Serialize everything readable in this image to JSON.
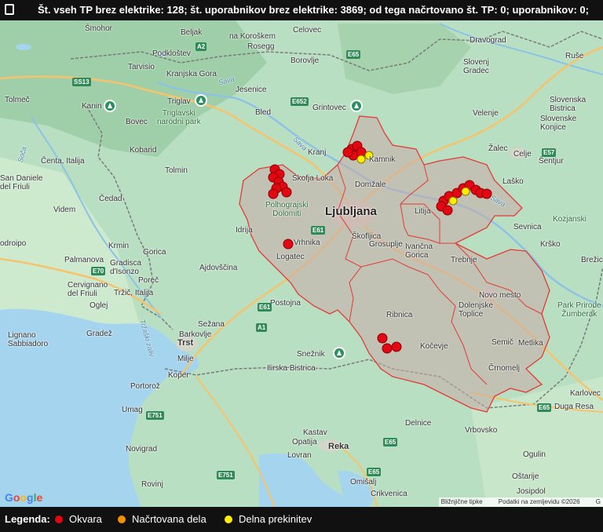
{
  "status_bar": {
    "text": "Št. vseh TP brez elektrike: 128; št. uporabnikov brez elektrike: 3869; od tega načrtovano št. TP: 0; uporabnikov: 0;"
  },
  "map": {
    "places": {
      "beljak": "Beljak",
      "celovec": "Celovec",
      "smohor": "Šmohor",
      "podklostev": "Podkloštev",
      "na_koroskem": "na Koroškem",
      "dravograd": "Dravograd",
      "rosegg": "Rosegg",
      "tarvisio": "Tarvisio",
      "kranjska_gora": "Kranjska Gora",
      "borovlje": "Borovlje",
      "slovenj_gradec": "Slovenj\nGradec",
      "ruse": "Ruše",
      "tolmec": "Tolmeč",
      "kanin": "Kanin",
      "triglav": "Triglav",
      "jesenice": "Jesenice",
      "grintovec": "Grintovec",
      "velenje": "Velenje",
      "slovenska_bistrica": "Slovenska\nBistrica",
      "triglavski_park": "Triglavski\nnarodni park",
      "bovec": "Bovec",
      "bled": "Bled",
      "slovenske_konjice": "Slovenske\nKonjice",
      "kobarid": "Kobarid",
      "kranj": "Kranj",
      "zalec": "Žalec",
      "celje": "Celje",
      "sentjur": "Šentjur",
      "centa_italija": "Čenta, Italija",
      "san_daniele": "San Daniele\ndel Friuli",
      "tolmin": "Tolmin",
      "skofja_loka": "Škofja Loka",
      "kamnik": "Kamnik",
      "domzale": "Domžale",
      "lasko": "Laško",
      "cedad": "Čedad",
      "polhograjski": "Polhograjski\nDolomiti",
      "ljubljana": "Ljubljana",
      "litija": "Litija",
      "kozjanski": "Kozjanski",
      "videm": "Videm",
      "idrija": "Idrija",
      "sevnica": "Sevnica",
      "codroipo": "odroipo",
      "krmin": "Krmin",
      "vrhnika": "Vrhnika",
      "skofljica": "Škofljica",
      "grosuplje": "Grosuplje",
      "ivancna_gorica": "Ivančna\nGorica",
      "krsko": "Krško",
      "gorica": "Gorica",
      "logatec": "Logatec",
      "brezice": "Brežic",
      "palmanova": "Palmanova",
      "gradisca": "Gradisca\nd'Isonzo",
      "ajdovscina": "Ajdovščina",
      "trebnje": "Trebnje",
      "cervignano": "Cervignano\ndel Friuli",
      "porec": "Poreč",
      "trzic_italija": "Tržič, Italija",
      "novo_mesto": "Novo mesto",
      "oglej": "Oglej",
      "postojna": "Postojna",
      "dolenjske_toplice": "Dolenjske\nToplice",
      "park_zumberak": "Park Prirode\nŽumberak",
      "ribnica": "Ribnica",
      "lignano": "Lignano\nSabbiadoro",
      "gradez": "Gradež",
      "sezana": "Sežana",
      "barkovlje": "Barkovlje",
      "trzaski_zaliv": "Tržaški zaliv",
      "trst": "Trst",
      "snieznik": "Snežnik",
      "kocevje": "Kočevje",
      "semic": "Semič",
      "metlika": "Metlika",
      "milje": "Milje",
      "ilirska_bistrica": "Ilirska Bistrica",
      "crnomelj": "Črnomelj",
      "koper": "Koper",
      "karlovec": "Karlovec",
      "portoroz": "Portorož",
      "duga_resa": "Duga Resa",
      "umag": "Umag",
      "delnice": "Delnice",
      "vrbovsko": "Vrbovsko",
      "kastav": "Kastav",
      "opatija": "Opatija",
      "reka": "Reka",
      "novigrad": "Novigrad",
      "lovran": "Lovran",
      "ogulin": "Ogulin",
      "omisalj": "Omišalj",
      "ostarije": "Oštarije",
      "crikvenica": "Crikvenica",
      "rovinj": "Rovinj",
      "josipdol": "Josipdol",
      "sava": "Sava",
      "soca": "Soča"
    },
    "shields": {
      "a2": "A2",
      "e65a": "E65",
      "e652": "E652",
      "s53": "SS13",
      "e57": "E57",
      "e61a": "E61",
      "e61b": "E61",
      "e70": "E70",
      "a1": "A1",
      "e65b": "E65",
      "e751a": "E751",
      "e751b": "E751",
      "e65c": "E65",
      "e65d": "E65"
    },
    "legend_colors": {
      "okvara": "#e30613",
      "nacrtovana": "#f39200",
      "delna": "#ffed00"
    },
    "attribution": {
      "shortcuts": "Bližnjične tipke",
      "map_data": "Podatki na zemljevidu ©2026",
      "g": "G"
    },
    "google_logo": [
      "G",
      "o",
      "o",
      "g",
      "l",
      "e"
    ]
  },
  "legend": {
    "title": "Legenda:",
    "items": [
      {
        "label": "Okvara",
        "color": "#e30613"
      },
      {
        "label": "Načrtovana dela",
        "color": "#f39200"
      },
      {
        "label": "Delna prekinitev",
        "color": "#ffed00"
      }
    ]
  }
}
